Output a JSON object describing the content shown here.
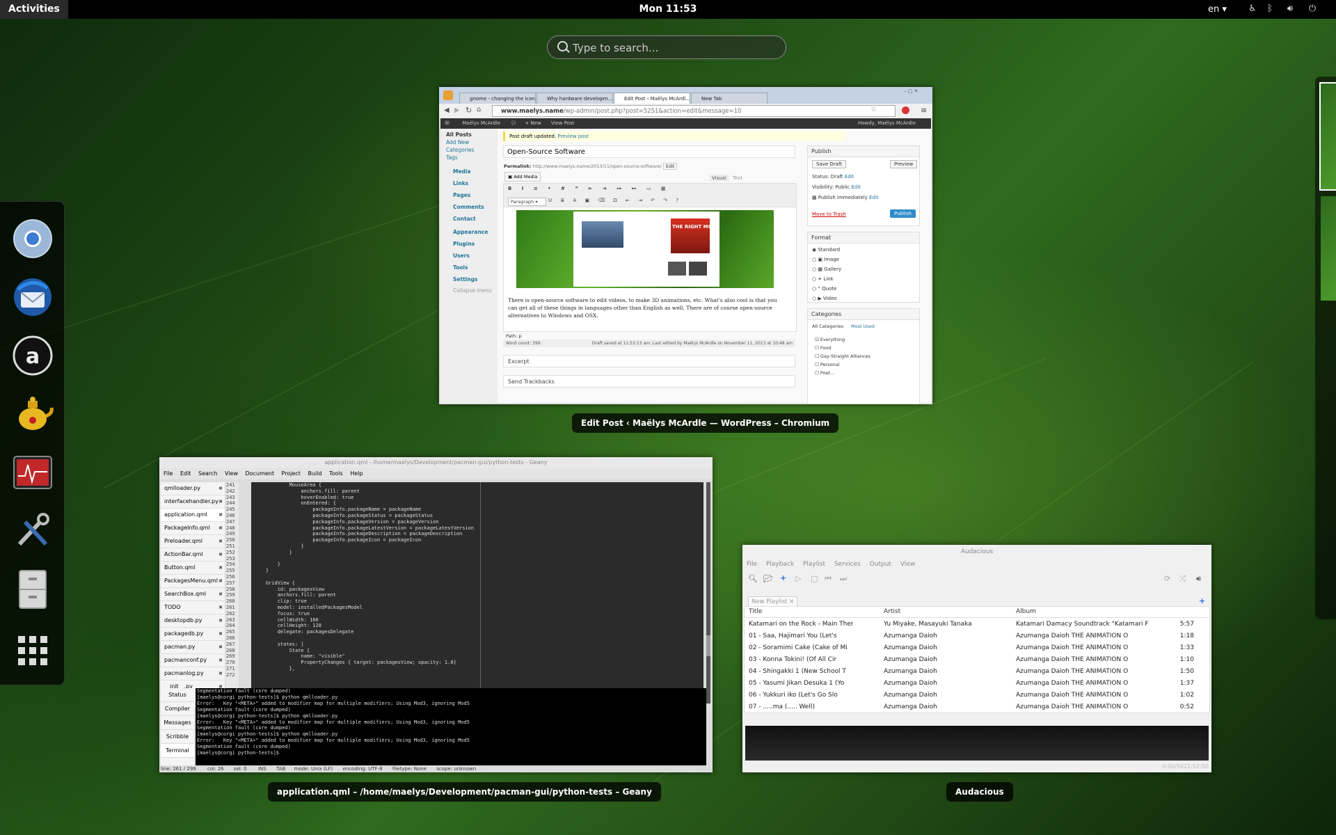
{
  "topbar": {
    "activities": "Activities",
    "clock": "Mon 11:53",
    "lang": "en ▾",
    "tray_icons": [
      "accessibility-icon",
      "bluetooth-icon",
      "volume-icon",
      "power-icon"
    ]
  },
  "search": {
    "placeholder": "Type to search..."
  },
  "dash": {
    "apps": [
      "chromium",
      "thunderbird",
      "amarok",
      "teapot",
      "system-monitor",
      "settings",
      "files",
      "show-apps"
    ]
  },
  "windows": {
    "chromium": {
      "label": "Edit Post ‹ Maëlys McArdle — WordPress – Chromium",
      "tabs": [
        "gnome - changing the icon...",
        "Why hardware developm...",
        "Edit Post ‹ Maëlys McArdl...",
        "New Tab"
      ],
      "url_host": "www.maelys.name",
      "url_path": "/wp-admin/post.php?post=5251&action=edit&message=10",
      "wpbar": {
        "site": "Maëlys McArdle",
        "new": "+ New",
        "view": "View Post",
        "howdy": "Howdy, Maëlys McArdle"
      },
      "sidebar": [
        "All Posts",
        "Add New",
        "Categories",
        "Tags",
        "Media",
        "Links",
        "Pages",
        "Comments",
        "Contact",
        "Appearance",
        "Plugins",
        "Users",
        "Tools",
        "Settings",
        "Collapse menu"
      ],
      "notice": "Post draft updated.",
      "notice_link": "Preview post",
      "post_title": "Open-Source Software",
      "permalink_label": "Permalink:",
      "permalink": "http://www.maelys.name/2013/11/open-source-software/",
      "edit": "Edit",
      "add_media": "Add Media",
      "visual": "Visual",
      "text": "Text",
      "format_select": "Paragraph",
      "body_text": "There is open-source software to edit videos, to make 3D animations, etc. What's also cool is that you can get all of these things in languages other than English as well. There are of course open-source alternatives to Windows and OSX.",
      "path": "Path: p",
      "word_count": "Word count: 399",
      "draft_saved": "Draft saved at 11:53:13 am. Last edited by Maëlys McArdle on November 11, 2013 at 10:48 am",
      "excerpt": "Excerpt",
      "trackbacks": "Send Trackbacks",
      "publish": {
        "title": "Publish",
        "save_draft": "Save Draft",
        "preview": "Preview",
        "status": "Status: Draft",
        "visibility": "Visibility: Public",
        "schedule": "Publish immediately",
        "edit_link": "Edit",
        "trash": "Move to Trash",
        "publish_btn": "Publish"
      },
      "format": {
        "title": "Format",
        "options": [
          "Standard",
          "Image",
          "Gallery",
          "Link",
          "Quote",
          "Video"
        ]
      },
      "categories": {
        "title": "Categories",
        "tab_all": "All Categories",
        "tab_used": "Most Used",
        "items": [
          "Everything",
          "Food",
          "Gay-Straight Alliances",
          "Personal",
          "Poet..."
        ]
      }
    },
    "geany": {
      "label": "application.qml – /home/maelys/Development/pacman-gui/python-tests – Geany",
      "title": "application.qml - /home/maelys/Development/pacman-gui/python-tests - Geany",
      "menu": [
        "File",
        "Edit",
        "Search",
        "View",
        "Document",
        "Project",
        "Build",
        "Tools",
        "Help"
      ],
      "files": [
        "qmlloader.py",
        "interfacehandler.py",
        "application.qml",
        "PackageInfo.qml",
        "Preloader.qml",
        "ActionBar.qml",
        "Button.qml",
        "PackagesMenu.qml",
        "SearchBox.qml",
        "TODO",
        "desktopdb.py",
        "packagedb.py",
        "pacman.py",
        "pacmanconf.py",
        "pacmanlog.py",
        "__init__.py"
      ],
      "line_numbers": [
        "241",
        "242",
        "243",
        "244",
        "245",
        "246",
        "247",
        "248",
        "249",
        "250",
        "251",
        "252",
        "253",
        "254",
        "255",
        "256",
        "257",
        "258",
        "259",
        "260",
        "261",
        "262",
        "263",
        "264",
        "265",
        "266",
        "267",
        "268",
        "269",
        "270",
        "271",
        "272"
      ],
      "code": [
        "            MouseArea {",
        "                anchors.fill: parent",
        "                hoverEnabled: true",
        "                onEntered: {",
        "                    packageInfo.packageName = packageName",
        "                    packageInfo.packageStatus = packageStatus",
        "                    packageInfo.packageVersion = packageVersion",
        "                    packageInfo.packageLatestVersion = packageLatestVersion",
        "                    packageInfo.packageDescription = packageDescription",
        "                    packageInfo.packageIcon = packageIcon",
        "                }",
        "            }",
        "",
        "        }",
        "    }",
        "",
        "    GridView {",
        "        id: packagesView",
        "        anchors.fill: parent",
        "        clip: true",
        "        model: installedPackagesModel",
        "        focus: true",
        "        cellWidth: 100",
        "        cellHeight: 128",
        "        delegate: packagesDelegate",
        "",
        "        states: [",
        "            State {",
        "                name: \"visible\"",
        "                PropertyChanges { target: packagesView; opacity: 1.0}",
        "            },",
        ""
      ],
      "msg_tabs": [
        "Status",
        "Compiler",
        "Messages",
        "Scribble",
        "Terminal"
      ],
      "terminal": [
        "Segmentation fault (core dumped)",
        "[maelys@corgi python-tests]$ python qmlloader.py",
        "Error:   Key \"<META>\" added to modifier map for multiple modifiers; Using Mod3, ignoring Mod5",
        "Segmentation fault (core dumped)",
        "[maelys@corgi python-tests]$ python qmlloader.py",
        "Error:   Key \"<META>\" added to modifier map for multiple modifiers; Using Mod3, ignoring Mod5",
        "Segmentation fault (core dumped)",
        "[maelys@corgi python-tests]$ python qmlloader.py",
        "Error:   Key \"<META>\" added to modifier map for multiple modifiers; Using Mod3, ignoring Mod5",
        "Segmentation fault (core dumped)",
        "[maelys@corgi python-tests]$ "
      ],
      "status": [
        "line: 261 / 299",
        "col: 26",
        "sel: 0",
        "INS",
        "TAB",
        "mode: Unix (LF)",
        "encoding: UTF-8",
        "filetype: None",
        "scope: unknown"
      ]
    },
    "audacious": {
      "label": "Audacious",
      "title": "Audacious",
      "menu": [
        "File",
        "Playback",
        "Playlist",
        "Services",
        "Output",
        "View"
      ],
      "playlist_tab": "New Playlist",
      "columns": [
        "Title",
        "Artist",
        "Album"
      ],
      "rows": [
        {
          "title": "Katamari on the Rock - Main Theme",
          "artist": "Yu Miyake, Masayuki Tanaka",
          "album": "Katamari Damacy Soundtrack \"Katamari For...",
          "time": "5:57"
        },
        {
          "title": "01 - Saa, Hajimari You (Let's",
          "artist": "Azumanga Daioh",
          "album": "Azumanga Daioh THE ANIMATION O",
          "time": "1:18"
        },
        {
          "title": "02 - Soramimi Cake (Cake of Mi",
          "artist": "Azumanga Daioh",
          "album": "Azumanga Daioh THE ANIMATION O",
          "time": "1:33"
        },
        {
          "title": "03 - Konna Tokini! (Of All Cir",
          "artist": "Azumanga Daioh",
          "album": "Azumanga Daioh THE ANIMATION O",
          "time": "1:10"
        },
        {
          "title": "04 - Shingakki 1 (New School T",
          "artist": "Azumanga Daioh",
          "album": "Azumanga Daioh THE ANIMATION O",
          "time": "1:50"
        },
        {
          "title": "05 - Yasumi Jikan Desuka 1 (Yo",
          "artist": "Azumanga Daioh",
          "album": "Azumanga Daioh THE ANIMATION O",
          "time": "1:37"
        },
        {
          "title": "06 - Yukkuri iko (Let's Go Slo",
          "artist": "Azumanga Daioh",
          "album": "Azumanga Daioh THE ANIMATION O",
          "time": "1:02"
        },
        {
          "title": "07 - .....ma (..... Well)",
          "artist": "Azumanga Daioh",
          "album": "Azumanga Daioh THE ANIMATION O",
          "time": "0:52"
        }
      ],
      "time_display": "0:00/5621:52:50"
    }
  },
  "colors": {
    "wp_blue": "#21759b",
    "publish_btn": "#2e8ccc",
    "terminal_bg": "#000000",
    "editor_bg": "#2b2b2b"
  }
}
